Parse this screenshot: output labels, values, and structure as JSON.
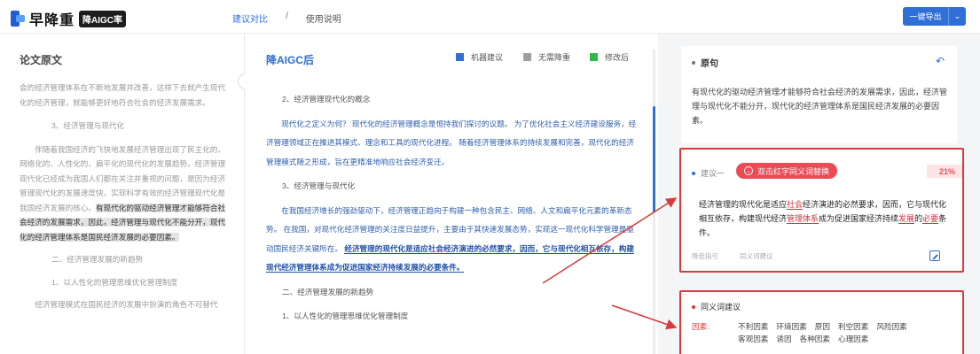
{
  "header": {
    "logo_text": "早降重",
    "logo_badge": "降AIGC率",
    "nav": {
      "compare": "建议对比",
      "separator": "/",
      "help": "使用说明"
    },
    "export_label": "一键导出"
  },
  "left": {
    "title": "论文原文",
    "p1": "会的经济管理体系在不断地发展并改善，这样下去就产生现代化的经济管理，就能够更好地符合社会的经济发展需求。",
    "h1": "3、经济管理与现代化",
    "p2_plain": "伴随着我国经济的飞快地发展经济管理出现了民主化的、网络化的、人性化的、扁平化的现代化的发展趋势。经济管理现代化已经成为我国人们都在关注并重视的问题，是因为经济管理现代化的发展速度快，实现科学有效的经济管理现代化是我国经济发展的核心。",
    "p2_highlight": "有现代化的驱动经济管理才能够符合社会经济的发展需求，因此，经济管理与现代化不能分开，现代化的经济管理体系是国民经济发展的必要因素。",
    "h2": "二、经济管理发展的新趋势",
    "h3": "1、以人性化的管理思维优化管理制度",
    "p3": "经济管理模式在国民经济的发展中扮演的角色不可替代"
  },
  "center": {
    "title": "降AIGC后",
    "legend": [
      {
        "label": "机器建议",
        "color": "#2f6fd6"
      },
      {
        "label": "无需降重",
        "color": "#9e9e9e"
      },
      {
        "label": "修改后",
        "color": "#2fb84a"
      }
    ],
    "s1": "2、经济管理现代化的概念",
    "p1": "现代化之定义为何？ 现代化的经济管理概念是恒持我们探讨的议题。 为了优化社会主义经济建设服务，经济管理领域正在推进其模式、理念和工具的现代化进程。 随着经济管理体系的持续发展和完善，现代化的经济管理模式随之形成，旨在更精准地响应社会经济变迁。",
    "s2": "3、经济管理与现代化",
    "p2": "在我国经济增长的强劲驱动下，经济管理正趋向于构建一种包含民主、网络、人文和扁平化元素的革新态势。 在我国，对现代化经济管理的关注度日益提升，主要由于其快速发展态势，实现这一现代化科学管理是驱动国民经济关键所在。",
    "p2_bold": "经济管理的现代化是适应社会经济演进的必然要求，因而，它与现代化相互依存，构建现代经济管理体系成为促进国家经济持续发展的必要条件。",
    "s3": "二、经济管理发展的新趋势",
    "s4": "1、以人性化的管理思维优化管理制度"
  },
  "right": {
    "original": {
      "title": "原句",
      "text": "有现代化的驱动经济管理才能够符合社会经济的发展需求，因此，经济管理与现代化不能分开，现代化的经济管理体系是国民经济发展的必要因素。"
    },
    "suggestion": {
      "label": "建议一",
      "tag": "双击红字同义词替换",
      "percent": "21%",
      "text_parts": [
        "经济管理的现代化是适应",
        "社会",
        "经济演进的必然要求，因而，它与现代化相互依存，构建现代经济",
        "管理体系",
        "成为促进国家经济持续",
        "发展",
        "的",
        "必要",
        "条件。"
      ],
      "footer_left": "降低指引",
      "footer_right": "同义词建议"
    },
    "synonyms": {
      "title": "同义词建议",
      "key": "因素:",
      "values": [
        "不利因素",
        "环境因素",
        "原因",
        "利空因素",
        "风险因素",
        "客观因素",
        "诱因",
        "各种因素",
        "心理因素"
      ]
    }
  }
}
